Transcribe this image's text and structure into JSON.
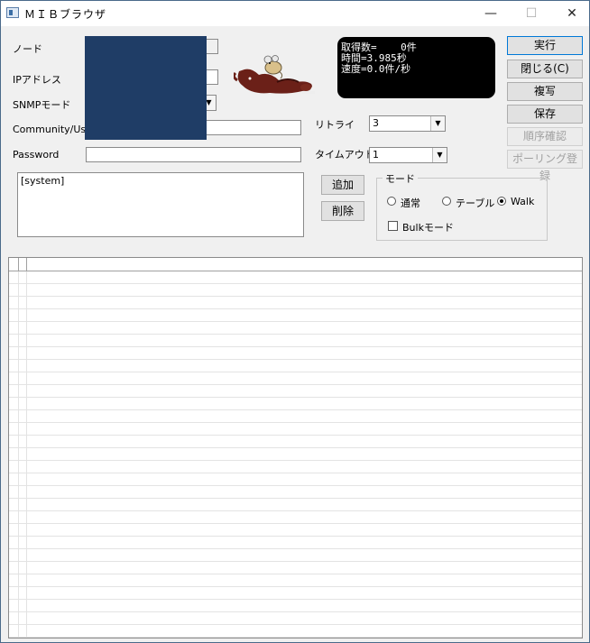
{
  "window": {
    "title": "ＭＩＢブラウザ",
    "minimize_glyph": "—",
    "maximize_glyph": "☐",
    "close_glyph": "✕"
  },
  "form": {
    "node_label": "ノード",
    "ip_label": "IPアドレス",
    "snmp_mode_label": "SNMPモード",
    "community_label": "Community/User",
    "password_label": "Password",
    "password_value": "",
    "retry_label": "リトライ",
    "retry_value": "3",
    "timeout_label": "タイムアウト",
    "timeout_value": "1"
  },
  "status": {
    "line1": "取得数=    0件",
    "line2": "時間=3.985秒",
    "line3": "速度=0.0件/秒"
  },
  "buttons": {
    "run": "実行",
    "close": "閉じる(C)",
    "copy": "複写",
    "save": "保存",
    "order_check": "順序確認",
    "polling_register": "ポーリング登録",
    "add": "追加",
    "delete": "削除"
  },
  "mib_list": {
    "items": [
      "[system]"
    ]
  },
  "mode_group": {
    "title": "モード",
    "normal": "通常",
    "table": "テーブル",
    "walk": "Walk",
    "selected": "walk",
    "bulk": "Bulkモード",
    "bulk_checked": false
  },
  "icons": {
    "dropdown": "chevron-down-icon",
    "mascot": "mascot-image"
  }
}
